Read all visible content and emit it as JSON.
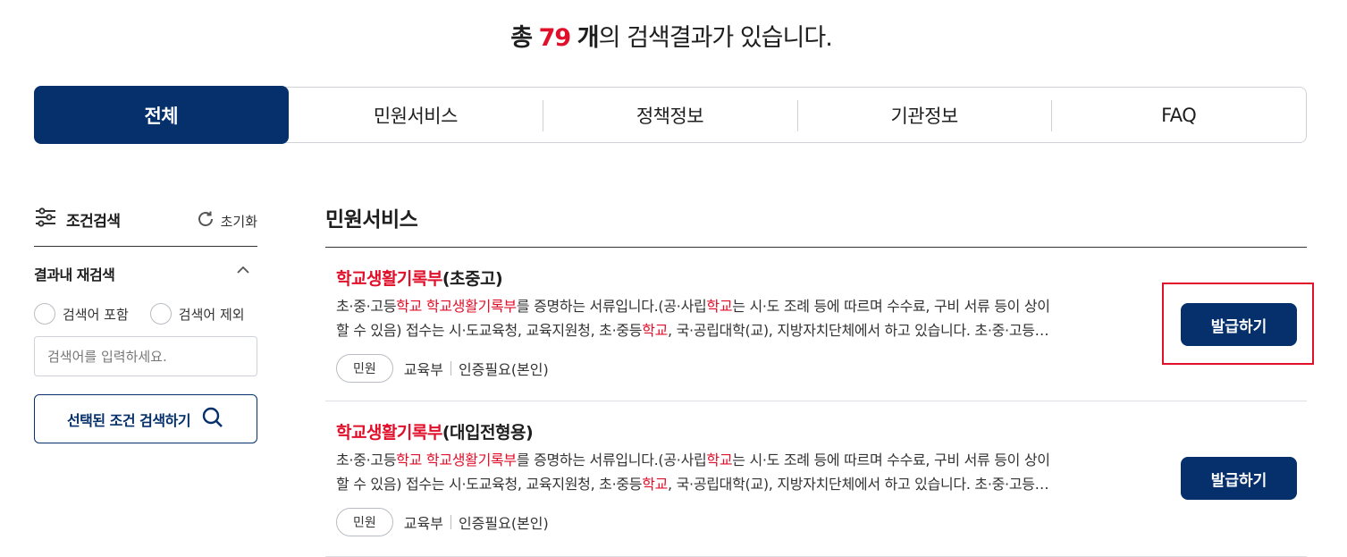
{
  "summary": {
    "prefix": "총",
    "count": "79",
    "unit": "개",
    "suffix": "의 검색결과가 있습니다."
  },
  "tabs": [
    {
      "label": "전체",
      "active": true
    },
    {
      "label": "민원서비스"
    },
    {
      "label": "정책정보"
    },
    {
      "label": "기관정보"
    },
    {
      "label": "FAQ"
    }
  ],
  "filter": {
    "title": "조건검색",
    "reset_label": "초기화",
    "research_title": "결과내 재검색",
    "include_label": "검색어 포함",
    "exclude_label": "검색어 제외",
    "input_placeholder": "검색어를 입력하세요.",
    "submit_label": "선택된 조건 검색하기"
  },
  "section": {
    "title": "민원서비스"
  },
  "results": [
    {
      "title_hl": "학교생활기록부",
      "title_rest": "(초중고)",
      "desc_line1": [
        {
          "t": "초·중·고등",
          "hl": false
        },
        {
          "t": "학교",
          "hl": true
        },
        {
          "t": " ",
          "hl": false
        },
        {
          "t": "학교생활기록부",
          "hl": true
        },
        {
          "t": "를 증명하는 서류입니다.(공·사립",
          "hl": false
        },
        {
          "t": "학교",
          "hl": true
        },
        {
          "t": "는 시·도 조례 등에 따르며 수수료, 구비 서류 등이 상이",
          "hl": false
        }
      ],
      "desc_line2": [
        {
          "t": "할 수 있음) 접수는 시·도교육청, 교육지원청, 초·중등",
          "hl": false
        },
        {
          "t": "학교",
          "hl": true
        },
        {
          "t": ", 국·공립대학(교), 지방자치단체에서 하고 있습니다. 초·중·고등…",
          "hl": false
        }
      ],
      "badge": "민원",
      "agency": "교육부",
      "auth": "인증필요(본인)",
      "button_label": "발급하기"
    },
    {
      "title_hl": "학교생활기록부",
      "title_rest": "(대입전형용)",
      "desc_line1": [
        {
          "t": "초·중·고등",
          "hl": false
        },
        {
          "t": "학교",
          "hl": true
        },
        {
          "t": " ",
          "hl": false
        },
        {
          "t": "학교생활기록부",
          "hl": true
        },
        {
          "t": "를 증명하는 서류입니다.(공·사립",
          "hl": false
        },
        {
          "t": "학교",
          "hl": true
        },
        {
          "t": "는 시·도 조례 등에 따르며 수수료, 구비 서류 등이 상이",
          "hl": false
        }
      ],
      "desc_line2": [
        {
          "t": "할 수 있음) 접수는 시·도교육청, 교육지원청, 초·중등",
          "hl": false
        },
        {
          "t": "학교",
          "hl": true
        },
        {
          "t": ", 국·공립대학(교), 지방자치단체에서 하고 있습니다. 초·중·고등…",
          "hl": false
        }
      ],
      "badge": "민원",
      "agency": "교육부",
      "auth": "인증필요(본인)",
      "button_label": "발급하기"
    }
  ],
  "colors": {
    "brand_navy": "#05306b",
    "highlight_red": "#e0102b"
  },
  "icons": [
    "sliders-icon",
    "refresh-icon",
    "chevron-up-icon",
    "search-icon"
  ]
}
